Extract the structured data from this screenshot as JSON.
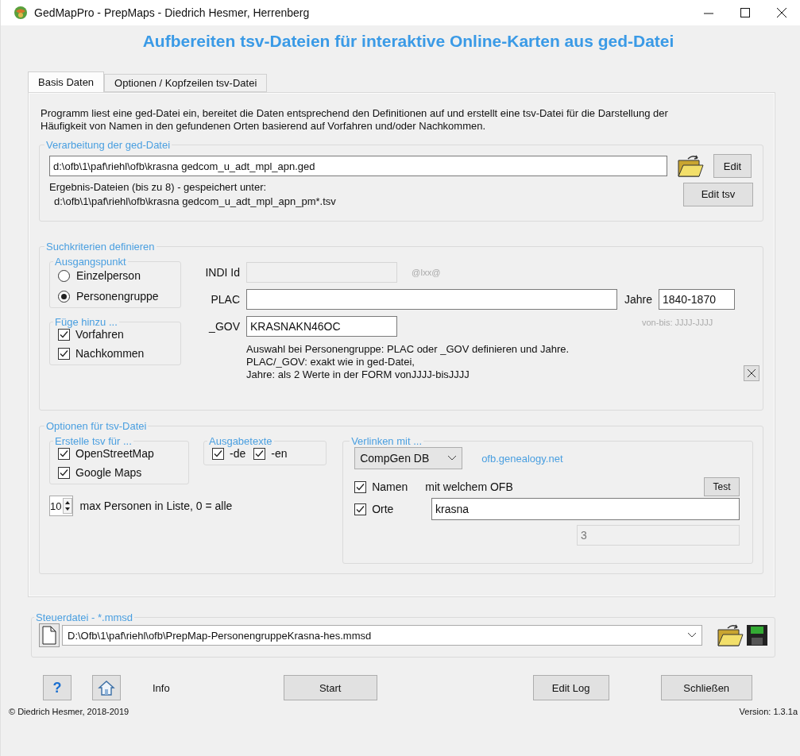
{
  "window": {
    "title": "GedMapPro - PrepMaps  -  Diedrich Hesmer, Herrenberg"
  },
  "heading": "Aufbereiten tsv-Dateien für interaktive Online-Karten aus ged-Datei",
  "tabs": [
    {
      "label": "Basis Daten",
      "selected": true
    },
    {
      "label": "Optionen / Kopfzeilen tsv-Datei",
      "selected": false
    }
  ],
  "description": "Programm liest eine ged-Datei ein, bereitet die Daten entsprechend den Definitionen auf und erstellt eine tsv-Datei für die Darstellung der Häufigkeit von Namen in den gefundenen Orten basierend auf Vorfahren und/oder Nachkommen.",
  "ged_group": {
    "title": "Verarbeitung der ged-Datei",
    "file": "d:\\ofb\\1\\paf\\riehl\\ofb\\krasna gedcom_u_adt_mpl_apn.ged",
    "edit_button": "Edit",
    "result_label": "Ergebnis-Dateien (bis zu 8) - gespeichert unter:",
    "result_path": "d:\\ofb\\1\\paf\\riehl\\ofb\\krasna gedcom_u_adt_mpl_apn_pm*.tsv",
    "edit_tsv_button": "Edit tsv"
  },
  "search_group": {
    "title": "Suchkriterien definieren",
    "start_group": {
      "title": "Ausgangspunkt",
      "options": [
        {
          "label": "Einzelperson",
          "selected": false
        },
        {
          "label": "Personengruppe",
          "selected": true
        }
      ]
    },
    "add_group": {
      "title": "Füge hinzu ...",
      "options": [
        {
          "label": "Vorfahren",
          "checked": true
        },
        {
          "label": "Nachkommen",
          "checked": true
        }
      ]
    },
    "indi": {
      "label": "INDI Id",
      "disabled": true,
      "hint": "@Ixx@"
    },
    "plac": {
      "label": "PLAC"
    },
    "gov": {
      "label": "_GOV",
      "value": "KRASNAKN46OC"
    },
    "years": {
      "label": "Jahre",
      "value": "1840-1870",
      "hint": "von-bis: JJJJ-JJJJ"
    },
    "notes": [
      "Auswahl bei Personengruppe: PLAC oder _GOV definieren und Jahre.",
      "PLAC/_GOV: exakt wie in ged-Datei,",
      "Jahre: als 2 Werte in der FORM vonJJJJ-bisJJJJ"
    ]
  },
  "options_group": {
    "title": "Optionen für tsv-Datei",
    "maps_group": {
      "title": "Erstelle tsv für ...",
      "options": [
        {
          "label": "OpenStreetMap",
          "checked": true
        },
        {
          "label": "Google Maps",
          "checked": true
        }
      ]
    },
    "texts_group": {
      "title": "Ausgabetexte",
      "options": [
        {
          "label": "-de",
          "checked": true
        },
        {
          "label": "-en",
          "checked": true
        }
      ]
    },
    "max_persons": {
      "value": "10",
      "label": "max Personen in Liste, 0 = alle"
    },
    "link_group": {
      "title": "Verlinken mit ...",
      "source": "CompGen DB",
      "link": "ofb.genealogy.net",
      "names": {
        "label": "Namen",
        "checked": true
      },
      "ofb_label": "mit welchem OFB",
      "test_button": "Test",
      "places": {
        "label": "Orte",
        "checked": true
      },
      "ofb_value": "krasna",
      "count": {
        "value": "3",
        "disabled": true
      }
    }
  },
  "control_group": {
    "title": "Steuerdatei - *.mmsd",
    "file": "D:\\Ofb\\1\\paf\\riehl\\ofb\\PrepMap-PersonengruppeKrasna-hes.mmsd"
  },
  "bottom": {
    "help": "?",
    "info": "Info",
    "start": "Start",
    "edit_log": "Edit Log",
    "close": "Schließen"
  },
  "footer": {
    "copyright": "© Diedrich Hesmer,  2018-2019",
    "version": "Version: 1.3.1a"
  }
}
